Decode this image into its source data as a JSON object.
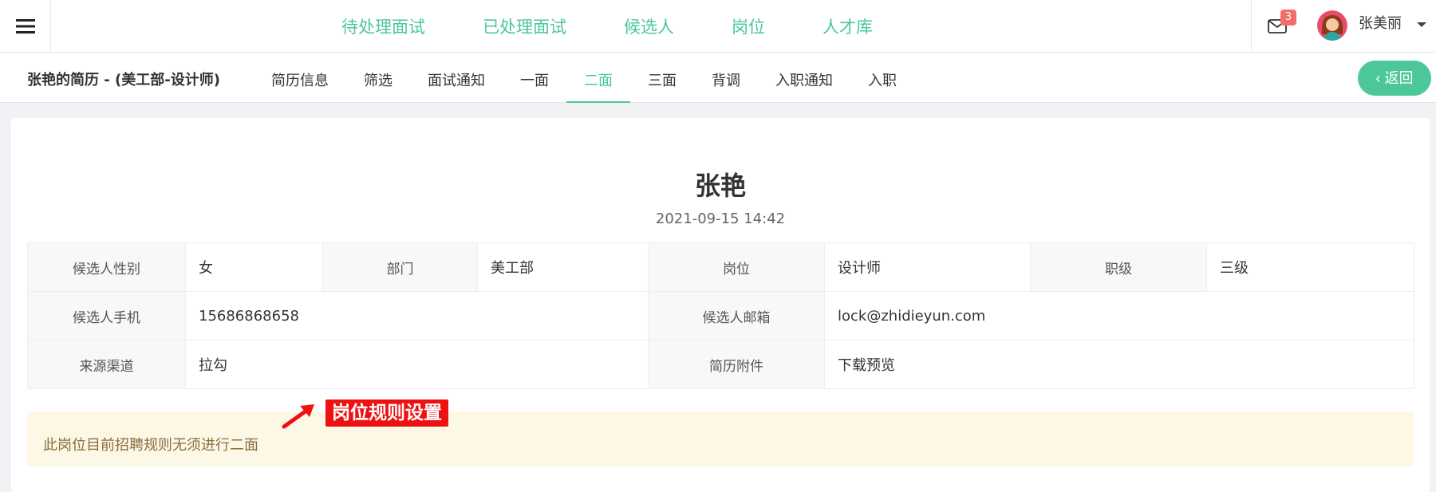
{
  "topnav": {
    "items": [
      "待处理面试",
      "已处理面试",
      "候选人",
      "岗位",
      "人才库"
    ]
  },
  "user": {
    "name": "张美丽",
    "mail_badge": "3"
  },
  "subnav": {
    "resume_title": "张艳的简历 - (美工部-设计师)",
    "tabs": [
      "简历信息",
      "筛选",
      "面试通知",
      "一面",
      "二面",
      "三面",
      "背调",
      "入职通知",
      "入职"
    ],
    "active_tab": "二面",
    "back_label": "返回"
  },
  "candidate": {
    "name": "张艳",
    "time": "2021-09-15 14:42"
  },
  "info": {
    "gender_label": "候选人性别",
    "gender": "女",
    "dept_label": "部门",
    "dept": "美工部",
    "position_label": "岗位",
    "position": "设计师",
    "level_label": "职级",
    "level": "三级",
    "phone_label": "候选人手机",
    "phone": "15686868658",
    "email_label": "候选人邮箱",
    "email": "lock@zhidieyun.com",
    "source_label": "来源渠道",
    "source": "拉勾",
    "attachment_label": "简历附件",
    "attachment": "下载预览"
  },
  "notice": "此岗位目前招聘规则无须进行二面",
  "annotation": "岗位规则设置",
  "colors": {
    "accent": "#4cc79a",
    "badge": "#f56c6c",
    "annotation": "#ee1111",
    "notice_bg": "#fdf7e6"
  }
}
